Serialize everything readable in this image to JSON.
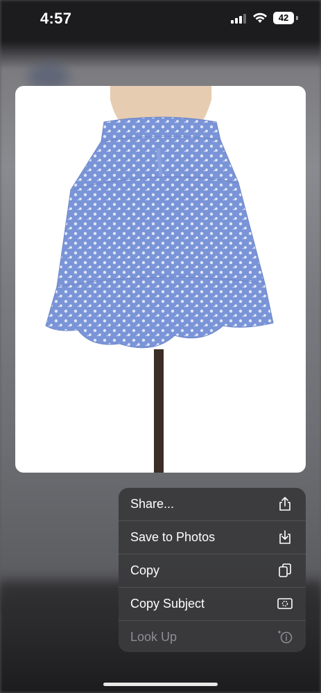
{
  "status_bar": {
    "time": "4:57",
    "battery_level": "42",
    "signal_bars": 3,
    "icons": [
      "cellular-signal-icon",
      "wifi-icon",
      "battery-icon"
    ]
  },
  "photo": {
    "subject": "blue floral tiered mini skirt on mannequin",
    "skirt_color": "#7a94d8",
    "background_color": "#ffffff"
  },
  "context_menu": {
    "items": [
      {
        "label": "Share...",
        "icon": "share-icon",
        "enabled": true
      },
      {
        "label": "Save to Photos",
        "icon": "save-download-icon",
        "enabled": true
      },
      {
        "label": "Copy",
        "icon": "copy-icon",
        "enabled": true
      },
      {
        "label": "Copy Subject",
        "icon": "copy-subject-icon",
        "enabled": true
      },
      {
        "label": "Look Up",
        "icon": "look-up-icon",
        "enabled": false
      }
    ]
  },
  "colors": {
    "menu_background": "#3a3a3c",
    "menu_text": "#ffffff",
    "menu_disabled_text": "#8e8e93"
  }
}
